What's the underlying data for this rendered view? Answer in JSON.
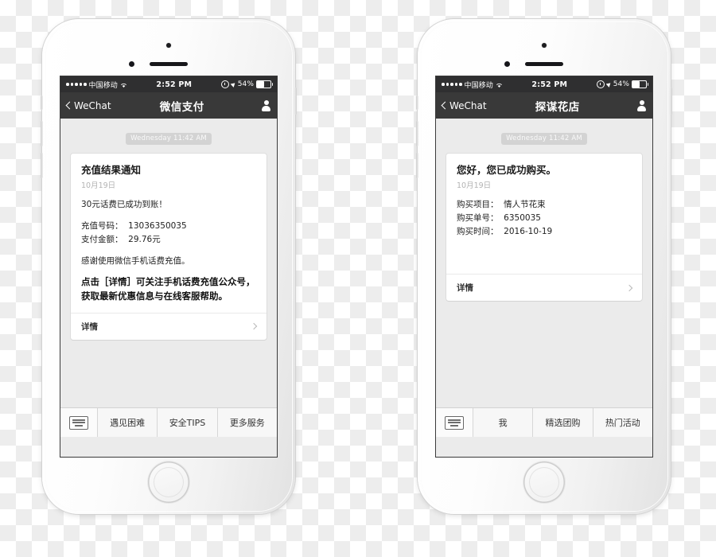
{
  "phones": [
    {
      "id": "wechat-pay",
      "status_bar": {
        "signal_dots": 5,
        "carrier": "中国移动",
        "wifi_icon": "wifi-icon",
        "time": "2:52 PM",
        "alarm_icon": "alarm-clock-icon",
        "location_icon": "location-arrow-icon",
        "battery_percent": "54%",
        "battery_fill": 54
      },
      "nav": {
        "back_label": "WeChat",
        "back_icon": "chevron-left-icon",
        "title": "微信支付",
        "profile_icon": "contact-person-icon"
      },
      "timestamp": "Wednesday 11:42 AM",
      "card": {
        "title": "充值结果通知",
        "date": "10月19日",
        "summary": "30元话费已成功到账！",
        "fields": [
          "充值号码：  13036350035",
          "支付金额：  29.76元"
        ],
        "thanks": "感谢使用微信手机话费充值。",
        "note": "点击［详情］可关注手机话费充值公众号，获取最新优惠信息与在线客服帮助。",
        "footer_label": "详情",
        "footer_icon": "chevron-right-icon"
      },
      "toolbar": {
        "keyboard_icon": "keyboard-icon",
        "items": [
          "遇见困难",
          "安全TIPS",
          "更多服务"
        ]
      }
    },
    {
      "id": "flower-shop",
      "status_bar": {
        "signal_dots": 5,
        "carrier": "中国移动",
        "wifi_icon": "wifi-icon",
        "time": "2:52 PM",
        "alarm_icon": "alarm-clock-icon",
        "location_icon": "location-arrow-icon",
        "battery_percent": "54%",
        "battery_fill": 54
      },
      "nav": {
        "back_label": "WeChat",
        "back_icon": "chevron-left-icon",
        "title": "探谋花店",
        "profile_icon": "contact-person-icon"
      },
      "timestamp": "Wednesday 11:42 AM",
      "card": {
        "title": "您好，您已成功购买。",
        "date": "10月19日",
        "summary": "",
        "fields": [
          "购买项目：  情人节花束",
          "购买单号：  6350035",
          "购买时间：  2016-10-19"
        ],
        "thanks": "",
        "note": "",
        "footer_label": "详情",
        "footer_icon": "chevron-right-icon"
      },
      "toolbar": {
        "keyboard_icon": "keyboard-icon",
        "items": [
          "我",
          "精选团购",
          "热门活动"
        ]
      }
    }
  ],
  "colors": {
    "statusbar_bg": "#2f2f30",
    "navbar_bg": "#393939",
    "chat_bg": "#ebebeb",
    "card_bg": "#ffffff",
    "toolbar_bg": "#f7f7f7",
    "timestamp_bg": "#d3d3d3"
  }
}
